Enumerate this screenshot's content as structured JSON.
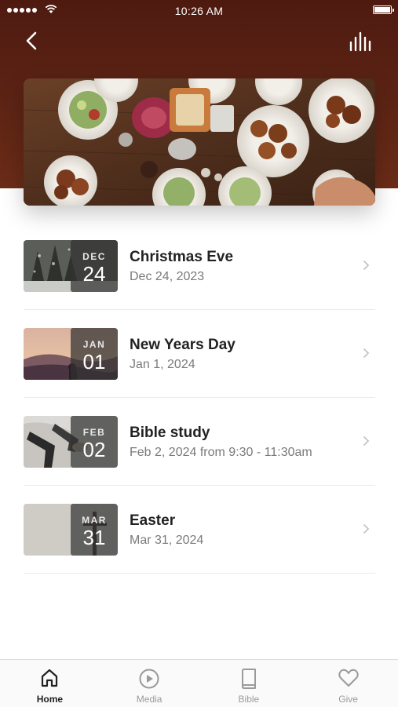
{
  "status_bar": {
    "time": "10:26 AM"
  },
  "header": {
    "back_icon": "back-chevron-icon",
    "menu_icon": "audio-bars-icon"
  },
  "hero": {
    "image": "dinner-table-photo"
  },
  "events": [
    {
      "title": "Christmas Eve",
      "subtitle": "Dec 24, 2023",
      "month": "DEC",
      "day": "24",
      "thumb": "snowy-forest"
    },
    {
      "title": "New Years Day",
      "subtitle": "Jan 1, 2024",
      "month": "JAN",
      "day": "01",
      "thumb": "sunset-hills"
    },
    {
      "title": "Bible study",
      "subtitle": "Feb 2, 2024 from 9:30 - 11:30am",
      "month": "FEB",
      "day": "02",
      "thumb": "people-sitting"
    },
    {
      "title": "Easter",
      "subtitle": "Mar 31, 2024",
      "month": "MAR",
      "day": "31",
      "thumb": "cross-wall"
    }
  ],
  "tabbar": {
    "tabs": [
      {
        "label": "Home",
        "icon": "home-icon",
        "active": true
      },
      {
        "label": "Media",
        "icon": "play-circle-icon",
        "active": false
      },
      {
        "label": "Bible",
        "icon": "book-icon",
        "active": false
      },
      {
        "label": "Give",
        "icon": "heart-icon",
        "active": false
      }
    ]
  },
  "colors": {
    "header": "#5a2214",
    "text": "#222222",
    "muted": "#7a7a7a",
    "tab_inactive": "#9a9a9a"
  }
}
